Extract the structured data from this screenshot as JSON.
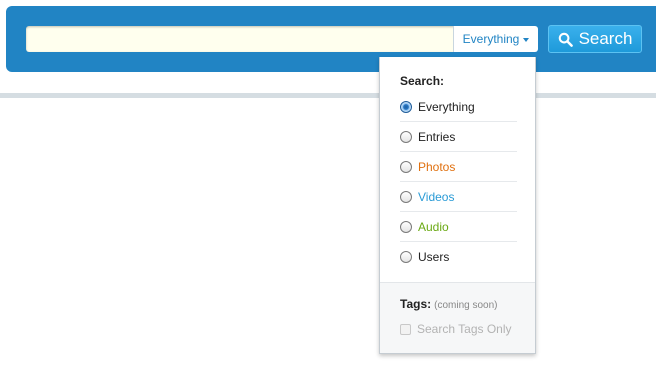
{
  "search": {
    "value": "",
    "placeholder": "",
    "scope_label": "Everything",
    "button_label": "Search"
  },
  "dropdown": {
    "heading": "Search:",
    "options": [
      {
        "label": "Everything",
        "color": "#222222",
        "selected": true
      },
      {
        "label": "Entries",
        "color": "#222222",
        "selected": false
      },
      {
        "label": "Photos",
        "color": "#e0700f",
        "selected": false
      },
      {
        "label": "Videos",
        "color": "#2a9bd6",
        "selected": false
      },
      {
        "label": "Audio",
        "color": "#6aa913",
        "selected": false
      },
      {
        "label": "Users",
        "color": "#222222",
        "selected": false
      }
    ],
    "tags": {
      "heading": "Tags:",
      "note": "(coming soon)",
      "checkbox_label": "Search Tags Only",
      "checked": false,
      "disabled": true
    }
  },
  "colors": {
    "bar": "#2184c4",
    "search_button": "#1e9ada",
    "input_bg": "#ffffee"
  }
}
